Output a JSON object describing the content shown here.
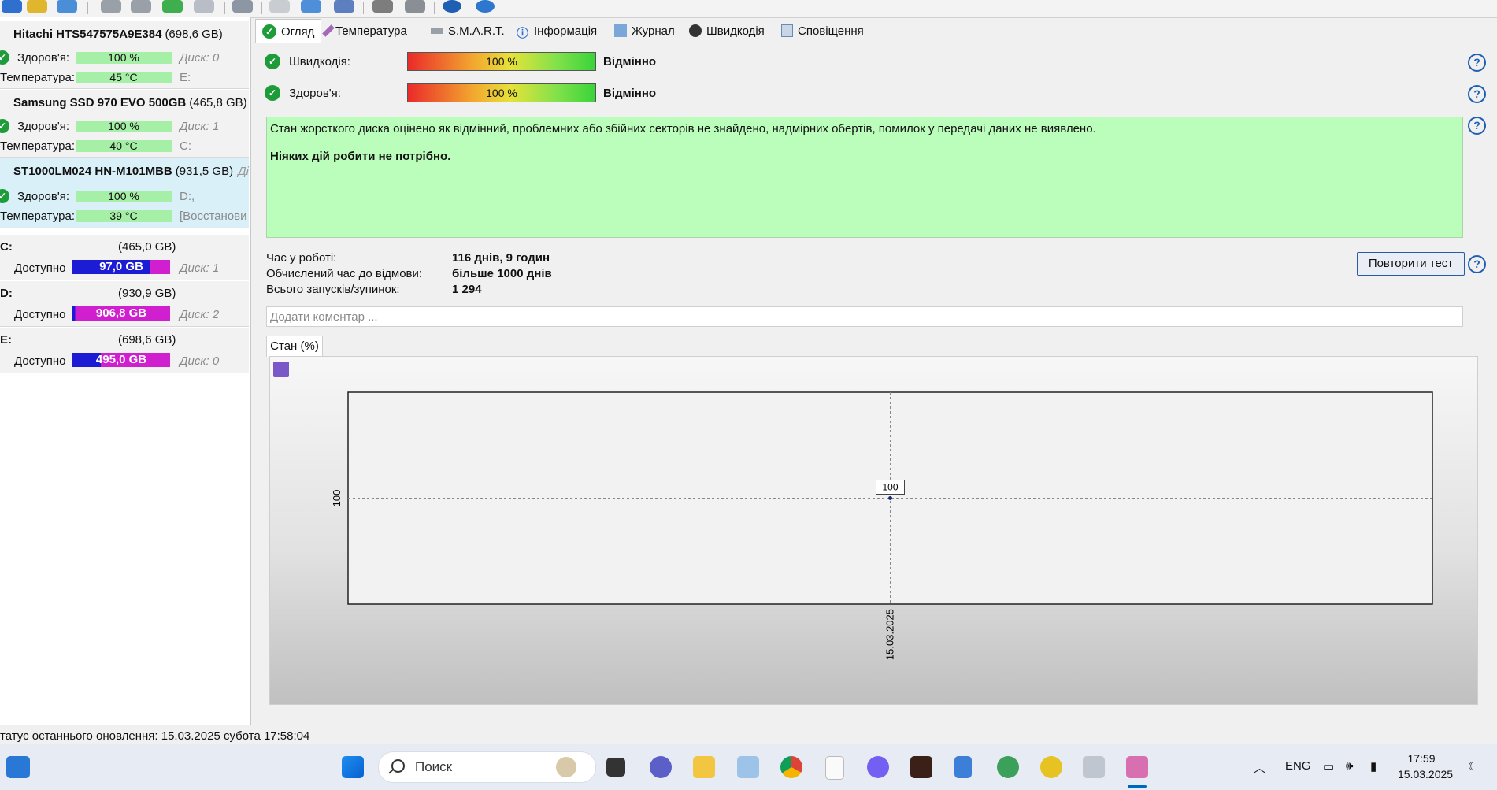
{
  "drives": [
    {
      "name": "Hitachi HTS547575A9E384",
      "size": "(698,6 GB)",
      "extra": "",
      "health_label": "Здоров'я:",
      "health": "100 %",
      "health_note": "Диск: 0",
      "temp_label": "Температура:",
      "temp": "45 °C",
      "temp_note": "E:"
    },
    {
      "name": "Samsung SSD 970 EVO 500GB",
      "size": "(465,8 GB)",
      "extra": "",
      "health_label": "Здоров'я:",
      "health": "100 %",
      "health_note": "Диск: 1",
      "temp_label": "Температура:",
      "temp": "40 °C",
      "temp_note": "C:"
    },
    {
      "name": "ST1000LM024 HN-M101MBB",
      "size": "(931,5 GB)",
      "extra": "Ді",
      "health_label": "Здоров'я:",
      "health": "100 %",
      "health_note": "D:,",
      "temp_label": "Температура:",
      "temp": "39 °C",
      "temp_note": "[Восстанови"
    }
  ],
  "volumes": [
    {
      "letter": "C:",
      "size": "(465,0 GB)",
      "avail_label": "Доступно",
      "avail": "97,0 GB",
      "fill": 0.79,
      "disk": "Диск: 1"
    },
    {
      "letter": "D:",
      "size": "(930,9 GB)",
      "avail_label": "Доступно",
      "avail": "906,8 GB",
      "fill": 0.03,
      "disk": "Диск: 2"
    },
    {
      "letter": "E:",
      "size": "(698,6 GB)",
      "avail_label": "Доступно",
      "avail": "495,0 GB",
      "fill": 0.29,
      "disk": "Диск: 0"
    }
  ],
  "tabs": [
    "Огляд",
    "Температура",
    "S.M.A.R.T.",
    "Інформація",
    "Журнал",
    "Швидкодія",
    "Сповіщення"
  ],
  "overview": {
    "performance_label": "Швидкодія:",
    "performance_value": "100 %",
    "performance_percent": 100,
    "performance_result": "Відмінно",
    "health_label": "Здоров'я:",
    "health_value": "100 %",
    "health_percent": 100,
    "health_result": "Відмінно",
    "message": "Стан жорсткого диска оцінено як відмінний, проблемних або збійних секторів не знайдено, надмірних обертів, помилок у передачі даних не виявлено.",
    "advice": "Ніяких дій робити не потрібно.",
    "uptime_label": "Час у роботі:",
    "uptime": "116 днів, 9 годин",
    "ttf_label": "Обчислений час до відмови:",
    "ttf": "більше 1000 днів",
    "starts_label": "Всього запусків/зупинок:",
    "starts": "1 294",
    "retest_button": "Повторити тест",
    "comment_placeholder": "Додати коментар ..."
  },
  "chart_tab": "Стан (%)",
  "chart_data": {
    "type": "line",
    "title": "",
    "x": [
      "15.03.2025"
    ],
    "series": [
      {
        "values": [
          100
        ]
      }
    ],
    "y_tick_labels": [
      "100"
    ],
    "point_labels": [
      "100"
    ],
    "grid": true
  },
  "status_text": "татус останнього оновлення: 15.03.2025 субота 17:58:04",
  "taskbar": {
    "search_text": "Поиск",
    "lang": "ENG",
    "time": "17:59",
    "date": "15.03.2025"
  },
  "colors": {
    "ok": "#1e9c3a",
    "health_bar": "#a6efa6",
    "msg_bg": "#bbfdbb",
    "vol_used": "#1c1cd4",
    "vol_free": "#cf1fcf"
  }
}
